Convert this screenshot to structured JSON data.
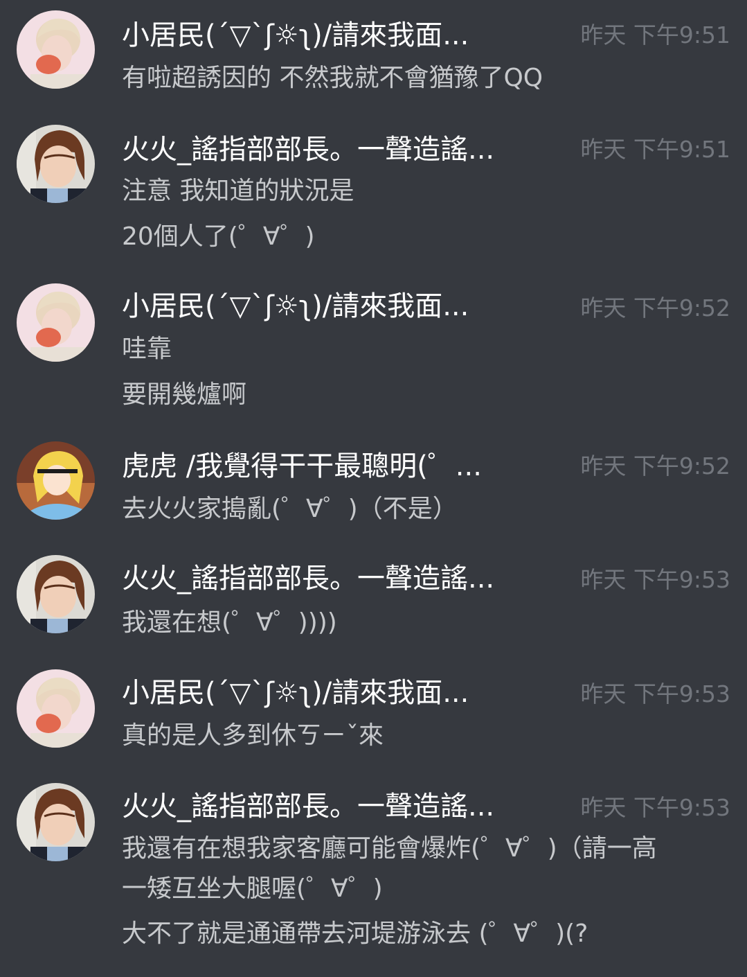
{
  "messages": [
    {
      "author": "小居民(´▽`ʃ☼ʅ)/請來我面...",
      "time": "昨天 下午9:51",
      "avatar": "avatar-blonde-icon",
      "lines": [
        "有啦超誘因的 不然我就不會猶豫了QQ"
      ]
    },
    {
      "author": "火火_謠指部部長。一聲造謠...",
      "time": "昨天 下午9:51",
      "avatar": "avatar-brown-hair-icon",
      "lines": [
        "注意 我知道的狀況是",
        "20個人了(゜∀゜)"
      ]
    },
    {
      "author": "小居民(´▽`ʃ☼ʅ)/請來我面...",
      "time": "昨天 下午9:52",
      "avatar": "avatar-blonde-icon",
      "lines": [
        "哇靠",
        "要開幾爐啊"
      ]
    },
    {
      "author": "虎虎 /我覺得干干最聰明(゜...",
      "time": "昨天 下午9:52",
      "avatar": "avatar-cartoon-alice-icon",
      "lines": [
        "去火火家搗亂(゜∀゜)（不是）"
      ]
    },
    {
      "author": "火火_謠指部部長。一聲造謠...",
      "time": "昨天 下午9:53",
      "avatar": "avatar-brown-hair-icon",
      "lines": [
        "我還在想(゜∀゜))))"
      ]
    },
    {
      "author": "小居民(´▽`ʃ☼ʅ)/請來我面...",
      "time": "昨天 下午9:53",
      "avatar": "avatar-blonde-icon",
      "lines": [
        "真的是人多到休ㄎㄧˇ來"
      ]
    },
    {
      "author": "火火_謠指部部長。一聲造謠...",
      "time": "昨天 下午9:53",
      "avatar": "avatar-brown-hair-icon",
      "lines": [
        "我還有在想我家客廳可能會爆炸(゜∀゜)（請一高",
        "一矮互坐大腿喔(゜∀゜)",
        "大不了就是通通帶去河堤游泳去 (゜∀゜)(?"
      ]
    }
  ]
}
